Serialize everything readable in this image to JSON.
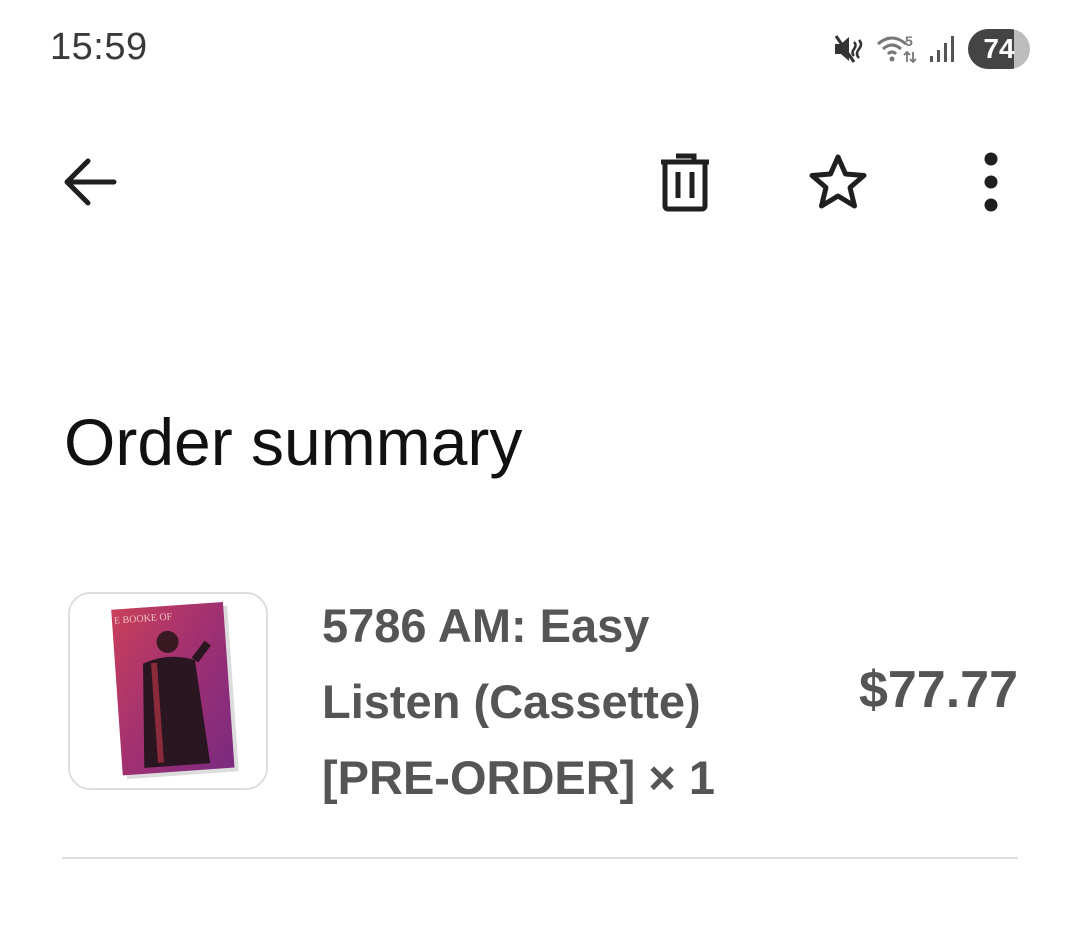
{
  "status_bar": {
    "time": "15:59",
    "battery": "74",
    "icons": [
      "mute-icon",
      "wifi-icon",
      "signal-icon",
      "battery-icon"
    ]
  },
  "toolbar": {
    "back_icon": "arrow-left-icon",
    "delete_icon": "trash-icon",
    "star_icon": "star-outline-icon",
    "more_icon": "more-vert-icon"
  },
  "page": {
    "title": "Order summary"
  },
  "order": {
    "items": [
      {
        "title": "5786 AM: Easy Listen (Cassette) [PRE-ORDER] × 1",
        "price": "$77.77",
        "cover_text": "E BOOKE OF",
        "image_icon": "cassette-cover-image"
      }
    ]
  },
  "colors": {
    "text_primary": "#111111",
    "text_secondary": "#555555",
    "divider": "#dcdcdc"
  }
}
